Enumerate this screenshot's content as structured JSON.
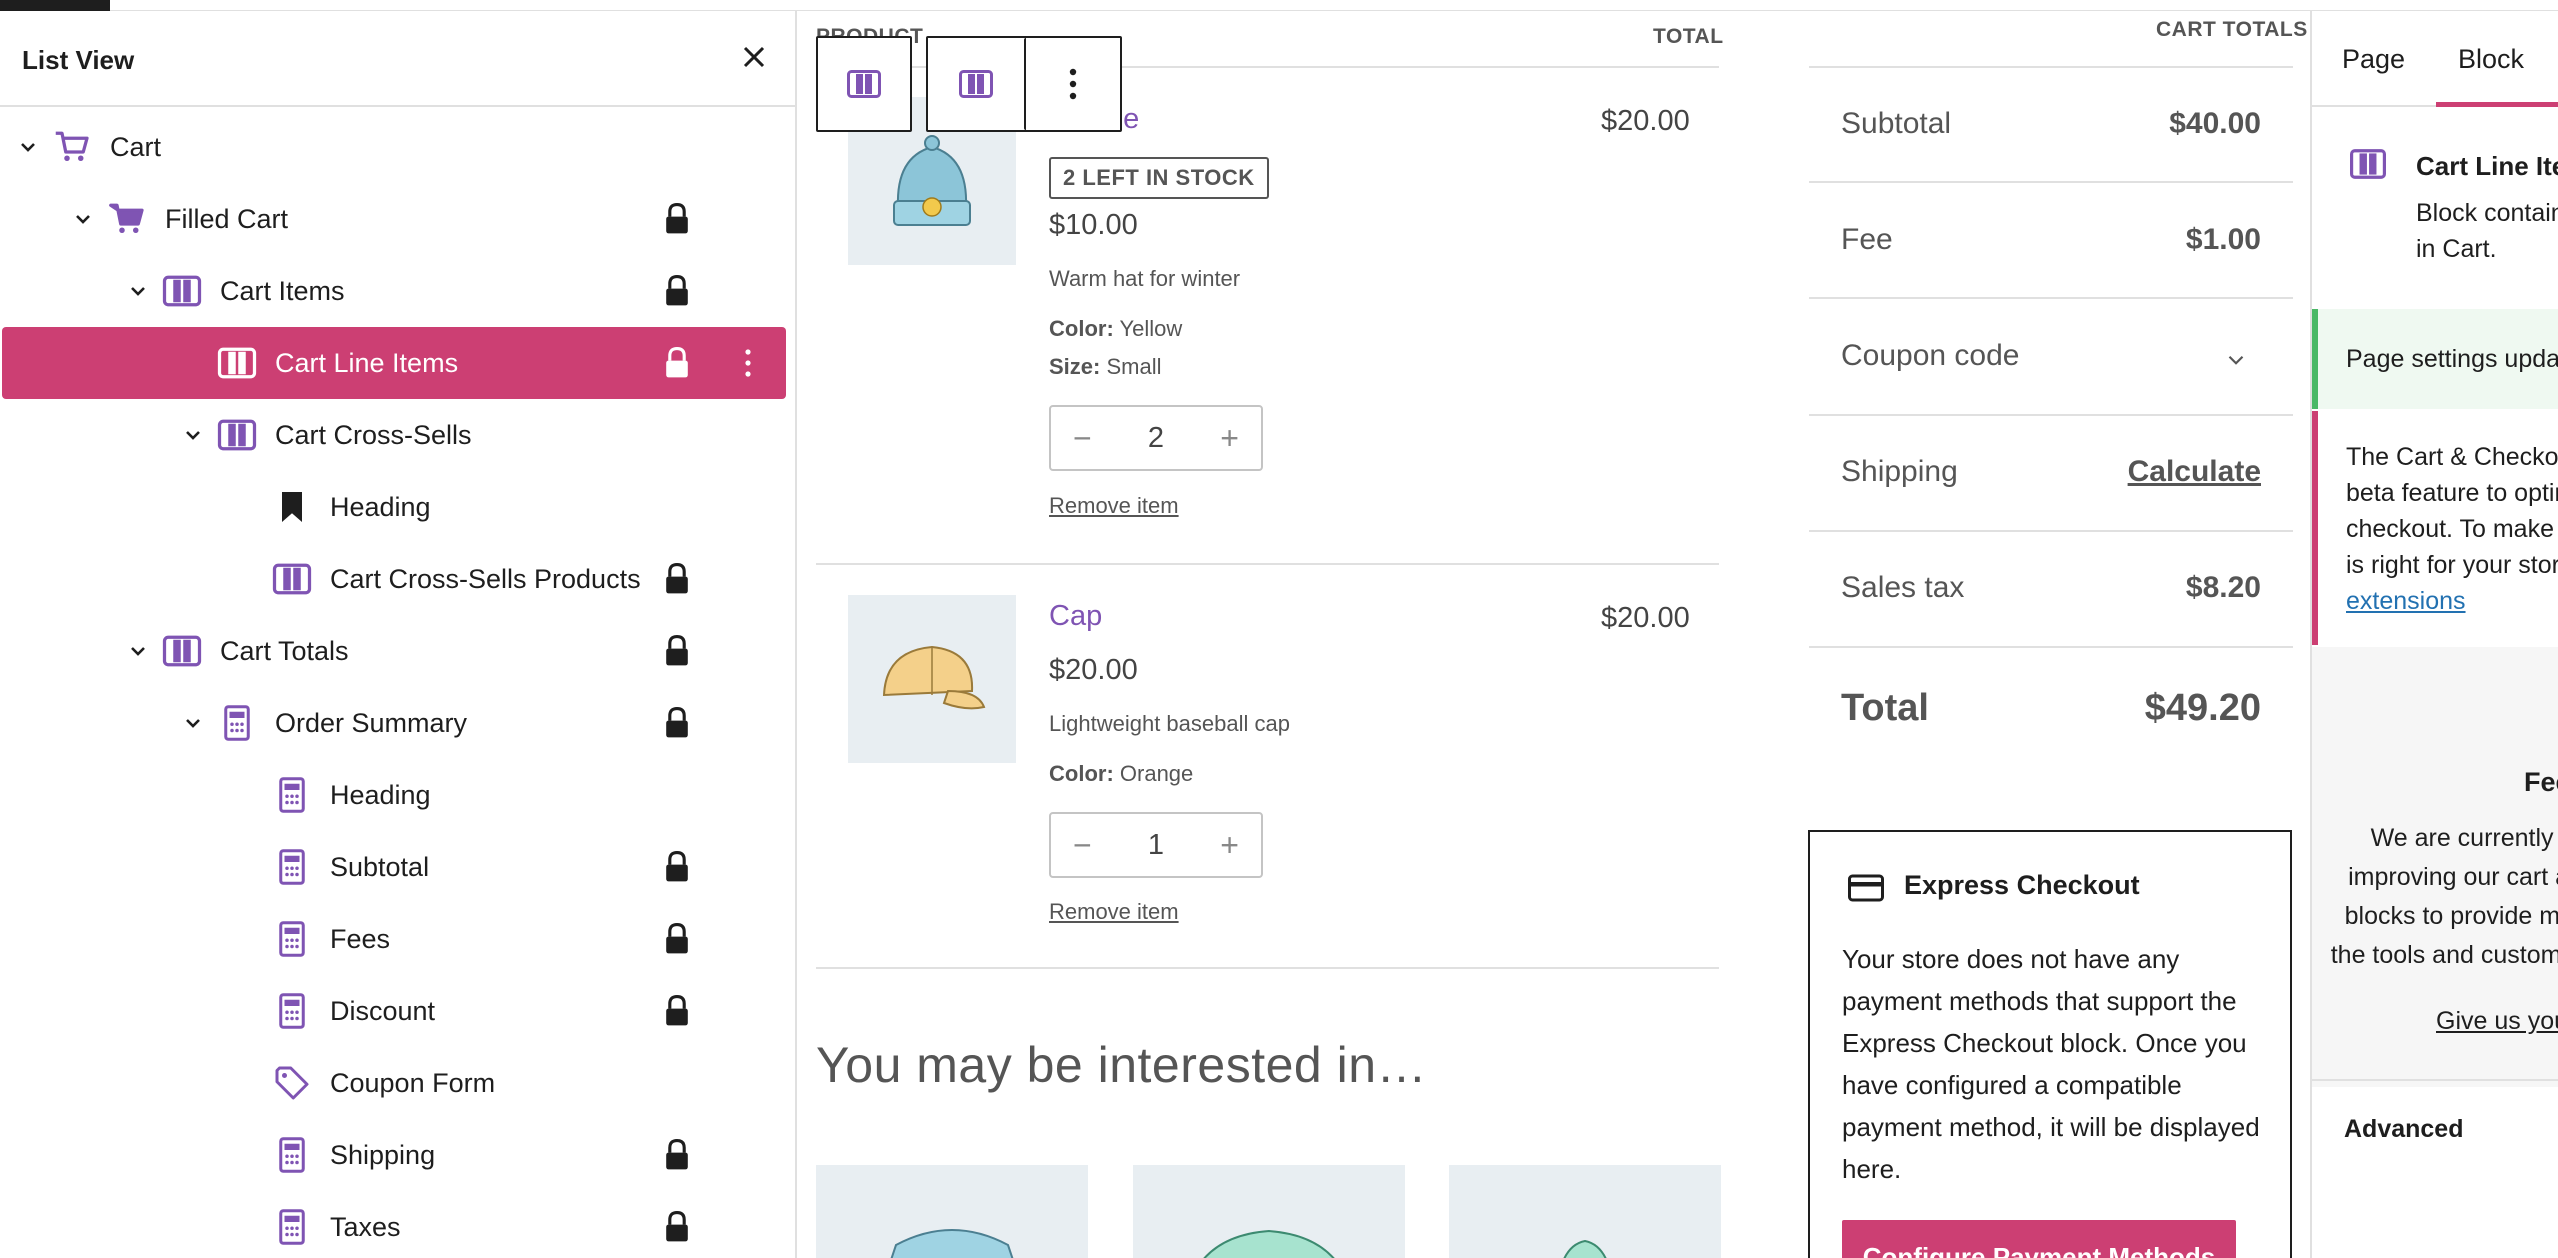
{
  "list_view": {
    "title": "List View",
    "items": [
      {
        "label": "Cart",
        "icon": "cart-icon",
        "level": 0,
        "expanded": true,
        "locked": false
      },
      {
        "label": "Filled Cart",
        "icon": "cart-filled-icon",
        "level": 1,
        "expanded": true,
        "locked": true
      },
      {
        "label": "Cart Items",
        "icon": "columns-icon",
        "level": 2,
        "expanded": true,
        "locked": true
      },
      {
        "label": "Cart Line Items",
        "icon": "columns-icon",
        "level": 3,
        "expanded": false,
        "locked": true,
        "selected": true
      },
      {
        "label": "Cart Cross-Sells",
        "icon": "columns-icon",
        "level": 3,
        "expanded": true,
        "locked": false
      },
      {
        "label": "Heading",
        "icon": "bookmark-icon",
        "level": 4,
        "expanded": false,
        "locked": false
      },
      {
        "label": "Cart Cross-Sells Products",
        "icon": "columns-icon",
        "level": 4,
        "expanded": false,
        "locked": true
      },
      {
        "label": "Cart Totals",
        "icon": "columns-icon",
        "level": 2,
        "expanded": true,
        "locked": true
      },
      {
        "label": "Order Summary",
        "icon": "calculator-icon",
        "level": 3,
        "expanded": true,
        "locked": true
      },
      {
        "label": "Heading",
        "icon": "calculator-icon",
        "level": 4,
        "expanded": false,
        "locked": false
      },
      {
        "label": "Subtotal",
        "icon": "calculator-icon",
        "level": 4,
        "expanded": false,
        "locked": true
      },
      {
        "label": "Fees",
        "icon": "calculator-icon",
        "level": 4,
        "expanded": false,
        "locked": true
      },
      {
        "label": "Discount",
        "icon": "calculator-icon",
        "level": 4,
        "expanded": false,
        "locked": true
      },
      {
        "label": "Coupon Form",
        "icon": "tag-icon",
        "level": 4,
        "expanded": false,
        "locked": false
      },
      {
        "label": "Shipping",
        "icon": "calculator-icon",
        "level": 4,
        "expanded": false,
        "locked": true
      },
      {
        "label": "Taxes",
        "icon": "calculator-icon",
        "level": 4,
        "expanded": false,
        "locked": true
      }
    ]
  },
  "canvas": {
    "columns": {
      "product": "PRODUCT",
      "total": "TOTAL",
      "cart_totals": "CART TOTALS"
    },
    "items": [
      {
        "name": "Beanie",
        "badge": "2 LEFT IN STOCK",
        "price": "$10.00",
        "line_total": "$20.00",
        "description": "Warm hat for winter",
        "attributes": [
          {
            "key": "Color:",
            "value": "Yellow"
          },
          {
            "key": "Size:",
            "value": "Small"
          }
        ],
        "quantity": "2",
        "remove": "Remove item"
      },
      {
        "name": "Cap",
        "badge": "",
        "price": "$20.00",
        "line_total": "$20.00",
        "description": "Lightweight baseball cap",
        "attributes": [
          {
            "key": "Color:",
            "value": "Orange"
          }
        ],
        "quantity": "1",
        "remove": "Remove item"
      }
    ],
    "interested_heading": "You may be interested in…",
    "totals": {
      "subtotal_label": "Subtotal",
      "subtotal_value": "$40.00",
      "fee_label": "Fee",
      "fee_value": "$1.00",
      "coupon_label": "Coupon code",
      "shipping_label": "Shipping",
      "shipping_value": "Calculate",
      "tax_label": "Sales tax",
      "tax_value": "$8.20",
      "total_label": "Total",
      "total_value": "$49.20"
    },
    "express": {
      "title": "Express Checkout",
      "text": "Your store does not have any payment methods that support the Express Checkout block. Once you have configured a compatible payment method, it will be displayed here.",
      "button": "Configure Payment Methods"
    }
  },
  "sidebar": {
    "tabs": [
      "Page",
      "Block"
    ],
    "active_tab": "Block",
    "block_title": "Cart Line Items",
    "block_desc": "Block containing current line items in Cart.",
    "notice_success": "Page settings updated.",
    "notice_warn_text": "The Cart & Checkout Blocks are a beta feature to optimize for faster checkout. To make sure this feature is right for your store, ",
    "notice_warn_link": "of compatible extensions",
    "feedback_title": "Feedback?",
    "feedback_text": "We are currently working on improving our cart and checkout blocks to provide merchants with the tools and customization options",
    "feedback_link": "Give us your feedback",
    "advanced": "Advanced"
  },
  "colors": {
    "accent": "#cc3f73",
    "purple": "#7f54b3",
    "success": "#4ab866",
    "link": "#2271b1"
  }
}
